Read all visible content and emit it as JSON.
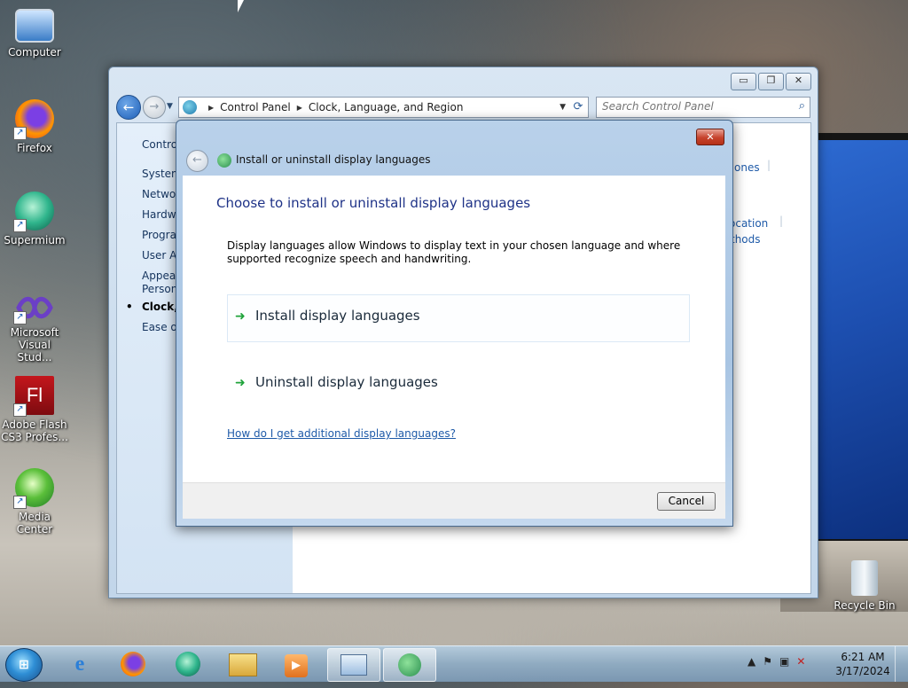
{
  "desktop": {
    "icons": [
      {
        "label": "Computer",
        "icon": "computer-icon"
      },
      {
        "label": "Firefox",
        "icon": "firefox-icon"
      },
      {
        "label": "Supermium",
        "icon": "supermium-icon"
      },
      {
        "label": "Microsoft Visual Stud...",
        "icon": "visual-studio-icon"
      },
      {
        "label": "Adobe Flash CS3 Profes...",
        "icon": "adobe-flash-icon"
      },
      {
        "label": "Media Center",
        "icon": "media-center-icon"
      },
      {
        "label": "Recycle Bin",
        "icon": "recycle-bin-icon"
      }
    ]
  },
  "control_panel": {
    "breadcrumb": [
      "Control Panel",
      "Clock, Language, and Region"
    ],
    "search_placeholder": "Search Control Panel",
    "left_nav": [
      "Control",
      "System",
      "Networ",
      "Hardwa",
      "Progra",
      "User Ac",
      "Appear",
      "Persona",
      "Clock, L",
      "Ease of"
    ],
    "right_fragments": [
      "ones",
      "ocation",
      "thods"
    ]
  },
  "dialog": {
    "title": "Install or uninstall display languages",
    "heading": "Choose to install or uninstall display languages",
    "description": "Display languages allow Windows to display text in your chosen language and where supported recognize speech and handwriting.",
    "options": [
      {
        "label": "Install display languages"
      },
      {
        "label": "Uninstall display languages"
      }
    ],
    "help_link": "How do I get additional display languages?",
    "cancel_label": "Cancel",
    "close_label": "✕"
  },
  "taskbar": {
    "start_label": "⊞",
    "clock_time": "6:21 AM",
    "clock_date": "3/17/2024"
  },
  "colors": {
    "accent_link": "#1e5aa8",
    "heading_blue": "#1e3287",
    "arrow_green": "#1fa33a",
    "close_red": "#c6422c"
  }
}
